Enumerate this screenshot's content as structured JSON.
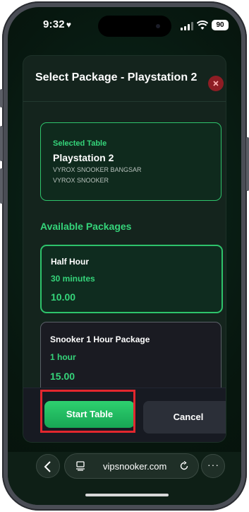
{
  "status": {
    "time": "9:32",
    "heart": "♥",
    "battery": "90"
  },
  "modal": {
    "title": "Select Package - Playstation 2",
    "close_icon": "close-icon"
  },
  "selected_table": {
    "label": "Selected Table",
    "name": "Playstation 2",
    "location": "VYROX SNOOKER BANGSAR",
    "brand": "VYROX SNOOKER"
  },
  "packages_title": "Available Packages",
  "packages": [
    {
      "name": "Half Hour",
      "duration": "30 minutes",
      "price": "10.00",
      "selected": true
    },
    {
      "name": "Snooker 1 Hour Package",
      "duration": "1 hour",
      "price": "15.00",
      "selected": false
    }
  ],
  "actions": {
    "start": "Start Table",
    "cancel": "Cancel"
  },
  "browser": {
    "url": "vipsnooker.com",
    "more": "···"
  },
  "colors": {
    "accent": "#2ec36b",
    "close": "#8e1d24",
    "highlight": "#e2272e"
  }
}
